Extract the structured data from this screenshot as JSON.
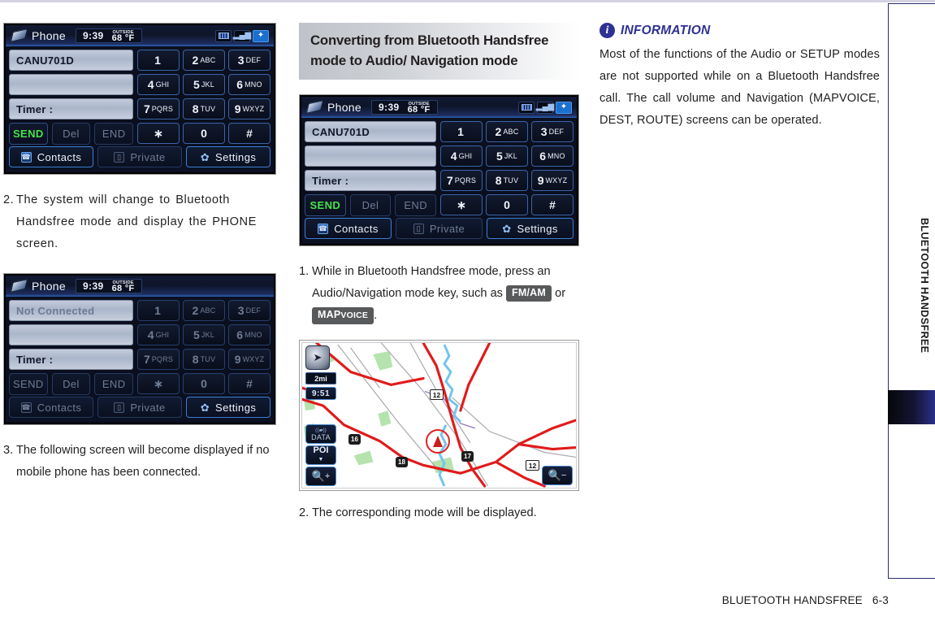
{
  "footer": {
    "chapter": "BLUETOOTH HANDSFREE",
    "page": "6-3"
  },
  "sidebar": {
    "label": "BLUETOOTH HANDSFREE"
  },
  "column1": {
    "step2": {
      "num": "2.",
      "text": "The system will change to Bluetooth Handsfree mode and display the PHONE screen."
    },
    "step3": {
      "num": "3.",
      "text": "The following screen will become displayed if no mobile phone has been connected."
    },
    "screen_connected": {
      "title": "Phone",
      "time": "9:39",
      "outside_label": "OUTSIDE",
      "temperature": "68",
      "temp_unit": "°F",
      "status_icons": [
        "battery-icon",
        "signal-icon",
        "bluetooth-icon"
      ],
      "field1": "CANU701D",
      "field2": "",
      "field3": "Timer :",
      "actions": [
        "SEND",
        "Del",
        "END"
      ],
      "keys": [
        {
          "digit": "1",
          "letters": ""
        },
        {
          "digit": "2",
          "letters": "ABC"
        },
        {
          "digit": "3",
          "letters": "DEF"
        },
        {
          "digit": "4",
          "letters": "GHI"
        },
        {
          "digit": "5",
          "letters": "JKL"
        },
        {
          "digit": "6",
          "letters": "MNO"
        },
        {
          "digit": "7",
          "letters": "PQRS"
        },
        {
          "digit": "8",
          "letters": "TUV"
        },
        {
          "digit": "9",
          "letters": "WXYZ"
        },
        {
          "digit": "∗",
          "letters": ""
        },
        {
          "digit": "0",
          "letters": ""
        },
        {
          "digit": "#",
          "letters": ""
        }
      ],
      "bottom": [
        "Contacts",
        "Private",
        "Settings"
      ]
    },
    "screen_not_connected": {
      "title": "Phone",
      "time": "9:39",
      "outside_label": "OUTSIDE",
      "temperature": "68",
      "temp_unit": "°F",
      "field1": "Not Connected",
      "field2": "",
      "field3": "Timer :",
      "actions": [
        "SEND",
        "Del",
        "END"
      ],
      "bottom": [
        "Contacts",
        "Private",
        "Settings"
      ]
    }
  },
  "column2": {
    "heading": "Converting from Bluetooth Handsfree mode to Audio/ Navigation mode",
    "step1": {
      "num": "1.",
      "text_before": "While in Bluetooth Handsfree mode, press an Audio/Navigation mode key, such as",
      "key1": "FM/AM",
      "conjunction": "or",
      "key2_main": "MAP",
      "key2_sub": "VOICE",
      "text_after": "."
    },
    "step2": {
      "num": "2.",
      "text": "The corresponding mode will be displayed."
    },
    "screen_phone": {
      "title": "Phone",
      "time": "9:39",
      "outside_label": "OUTSIDE",
      "temperature": "68",
      "temp_unit": "°F",
      "field1": "CANU701D",
      "field3": "Timer :",
      "actions": [
        "SEND",
        "Del",
        "END"
      ],
      "bottom": [
        "Contacts",
        "Private",
        "Settings"
      ]
    },
    "map": {
      "compass_icon": "compass-icon",
      "scale": "2mi",
      "clock": "9:51",
      "data_label": "DATA",
      "poi_label": "POI",
      "zoom_in": "zoom-in-icon",
      "zoom_out": "zoom-out-icon",
      "shields": [
        "12",
        "12"
      ],
      "interstates": [
        "16",
        "17",
        "18"
      ]
    }
  },
  "column3": {
    "info": {
      "icon": "info-icon",
      "title": "INFORMATION",
      "body": "Most of the functions of the Audio or SETUP modes are not supported while on a Bluetooth Handsfree call. The call volume and Navigation (MAPVOICE, DEST, ROUTE) screens can be operated."
    }
  }
}
